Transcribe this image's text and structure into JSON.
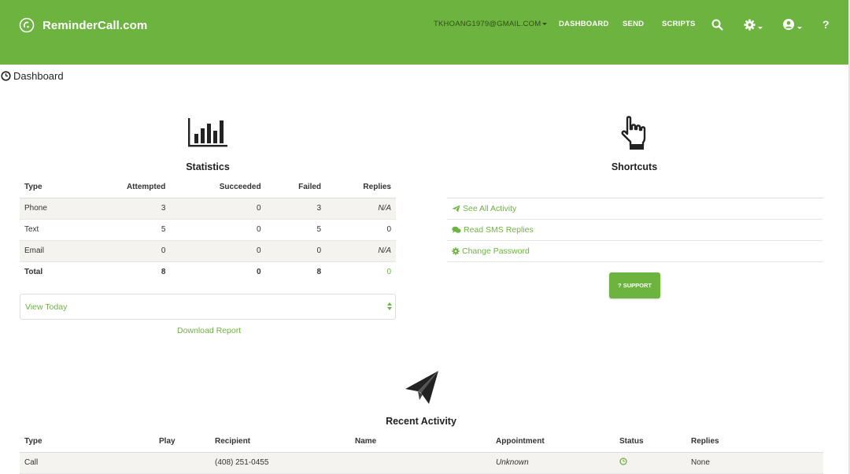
{
  "brand": {
    "name": "ReminderCall.com"
  },
  "nav": {
    "user_email": "TKHOANG1979@GMAIL.COM",
    "links": [
      "DASHBOARD",
      "SEND",
      "SCRIPTS"
    ],
    "icons": [
      "search-icon",
      "gear-icon",
      "user-icon",
      "help-icon"
    ],
    "help_label": "?"
  },
  "page": {
    "title": "Dashboard"
  },
  "statistics": {
    "title": "Statistics",
    "columns": [
      "Type",
      "Attempted",
      "Succeeded",
      "Failed",
      "Replies"
    ],
    "rows": [
      [
        "Phone",
        "3",
        "0",
        "3",
        "N/A"
      ],
      [
        "Text",
        "5",
        "0",
        "5",
        "0"
      ],
      [
        "Email",
        "0",
        "0",
        "0",
        "N/A"
      ]
    ],
    "total": [
      "Total",
      "8",
      "0",
      "8",
      "0"
    ],
    "period_select": "View Today",
    "download_label": "Download Report"
  },
  "shortcuts": {
    "title": "Shortcuts",
    "items": [
      {
        "label": "See All Activity",
        "icon": "send-icon"
      },
      {
        "label": "Read SMS Replies",
        "icon": "chat-icon"
      },
      {
        "label": "Change Password",
        "icon": "gear-icon"
      }
    ],
    "support_label": "? SUPPORT"
  },
  "recent_activity": {
    "title": "Recent Activity",
    "columns": [
      "Type",
      "Play",
      "Recipient",
      "Name",
      "Appointment",
      "Status",
      "Replies"
    ],
    "rows": [
      {
        "type": "Call",
        "play": "",
        "recipient": "(408) 251-0455",
        "name": "",
        "appointment": "Unknown",
        "status_icon": "clock-icon",
        "replies": "None"
      }
    ]
  },
  "colors": {
    "brand": "#6db33f",
    "stripe": "#f5f3ef"
  }
}
